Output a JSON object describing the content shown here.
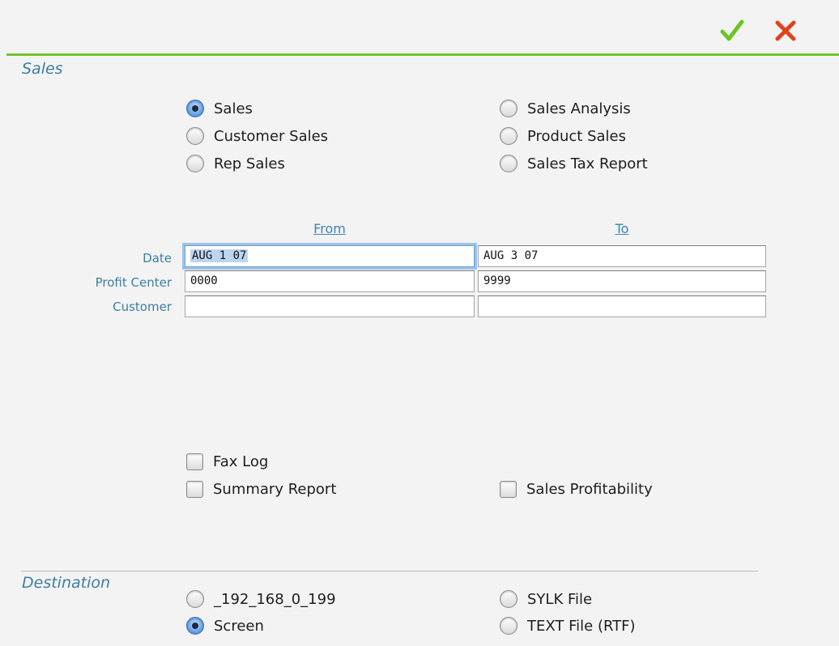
{
  "toolbar": {
    "ok_icon": "checkmark-icon",
    "cancel_icon": "close-icon",
    "ok_color": "#6cc424",
    "cancel_color": "#e0431f"
  },
  "sales_section": {
    "title": "Sales",
    "report_types": [
      {
        "label": "Sales",
        "selected": true
      },
      {
        "label": "Customer Sales",
        "selected": false
      },
      {
        "label": "Rep Sales",
        "selected": false
      },
      {
        "label": "Sales Analysis",
        "selected": false
      },
      {
        "label": "Product Sales",
        "selected": false
      },
      {
        "label": "Sales Tax Report",
        "selected": false
      }
    ]
  },
  "range": {
    "from_header": "From",
    "to_header": "To",
    "rows": [
      {
        "label": "Date",
        "from": "AUG 1 07",
        "to": "AUG 3 07"
      },
      {
        "label": "Profit Center",
        "from": "0000",
        "to": "9999"
      },
      {
        "label": "Customer",
        "from": "",
        "to": ""
      }
    ]
  },
  "options": {
    "fax_log": {
      "label": "Fax Log",
      "checked": false
    },
    "summary_report": {
      "label": "Summary Report",
      "checked": false
    },
    "sales_profitability": {
      "label": "Sales Profitability",
      "checked": false
    }
  },
  "destination": {
    "title": "Destination",
    "choices": [
      {
        "label": "_192_168_0_199",
        "selected": false
      },
      {
        "label": "Screen",
        "selected": true
      },
      {
        "label": "SYLK File",
        "selected": false
      },
      {
        "label": "TEXT File (RTF)",
        "selected": false
      }
    ]
  }
}
